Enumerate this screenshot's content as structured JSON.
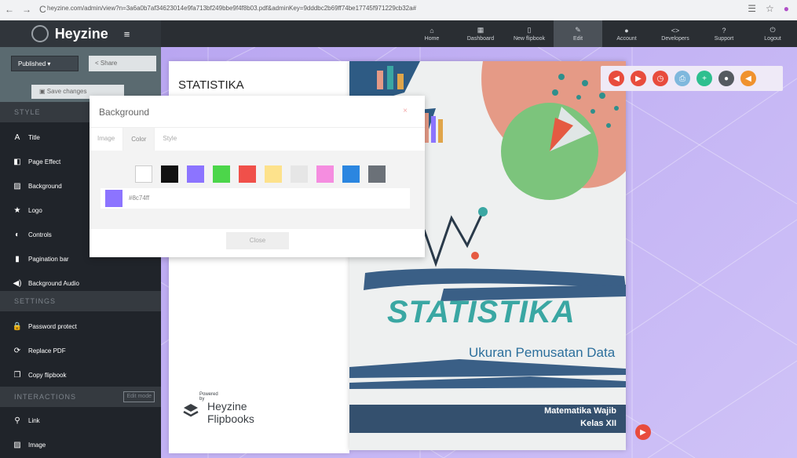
{
  "browser": {
    "back": "←",
    "forward": "→",
    "reload": "C",
    "url": "heyzine.com/admin/view?n=3a6a0b7af34623014e9fa713bf249bbe9f4f8b03.pdf&adminKey=9dddbc2b69ff74be17745f9712​29cb32a#"
  },
  "topnav": {
    "brand": "Heyzine",
    "menu_icon": "≡",
    "items": [
      {
        "label": "Home",
        "icon": "home-icon",
        "glyph": "⌂"
      },
      {
        "label": "Dashboard",
        "icon": "dashboard-icon",
        "glyph": "▦"
      },
      {
        "label": "New flipbook",
        "icon": "file-icon",
        "glyph": "▯"
      },
      {
        "label": "Edit",
        "icon": "pencil-icon",
        "glyph": "✎"
      },
      {
        "label": "Account",
        "icon": "user-icon",
        "glyph": "●"
      },
      {
        "label": "Developers",
        "icon": "code-icon",
        "glyph": "<>"
      },
      {
        "label": "Support",
        "icon": "question-icon",
        "glyph": "?"
      },
      {
        "label": "Logout",
        "icon": "power-icon",
        "glyph": "⏻"
      }
    ]
  },
  "sidebar": {
    "published_label": "Published ▾",
    "share_label": "Share",
    "save_label": "Save changes",
    "sections": {
      "style": "STYLE",
      "settings": "SETTINGS",
      "interactions": "INTERACTIONS",
      "edit_mode": "Edit mode"
    },
    "style_items": [
      {
        "label": "Title",
        "icon": "title-icon",
        "glyph": "A"
      },
      {
        "label": "Page Effect",
        "icon": "page-effect-icon",
        "glyph": "◧"
      },
      {
        "label": "Background",
        "icon": "image-icon",
        "glyph": "▨"
      },
      {
        "label": "Logo",
        "icon": "star-icon",
        "glyph": "★"
      },
      {
        "label": "Controls",
        "icon": "toggle-icon",
        "glyph": "◐"
      },
      {
        "label": "Pagination bar",
        "icon": "bookmark-icon",
        "glyph": "▮"
      },
      {
        "label": "Background Audio",
        "icon": "speaker-icon",
        "glyph": "◀)"
      }
    ],
    "settings_items": [
      {
        "label": "Password protect",
        "icon": "lock-icon",
        "glyph": "🔒"
      },
      {
        "label": "Replace PDF",
        "icon": "refresh-icon",
        "glyph": "⟳"
      },
      {
        "label": "Copy flipbook",
        "icon": "copy-icon",
        "glyph": "❐"
      }
    ],
    "interaction_items": [
      {
        "label": "Link",
        "icon": "link-icon",
        "glyph": "⚲"
      },
      {
        "label": "Image",
        "icon": "image-icon",
        "glyph": "▨"
      }
    ]
  },
  "left_page": {
    "title": "STATISTIKA"
  },
  "powered": {
    "small": "Powered by",
    "line1": "Heyzine",
    "line2": "Flipbooks"
  },
  "cover": {
    "title": "STATISTIKA",
    "subtitle": "Ukuran Pemusatan Data",
    "foot1": "Matematika Wajib",
    "foot2": "Kelas XII"
  },
  "toolbar": {
    "buttons": [
      {
        "icon": "previous-icon",
        "glyph": "◀",
        "color": "#e84c3d"
      },
      {
        "icon": "next-icon",
        "glyph": "▶",
        "color": "#e84c3d"
      },
      {
        "icon": "autoplay-icon",
        "glyph": "◷",
        "color": "#e84c3d"
      },
      {
        "icon": "print-icon",
        "glyph": "⎙",
        "color": "#7fb8dd"
      },
      {
        "icon": "zoom-in-icon",
        "glyph": "+",
        "color": "#2fbf8f"
      },
      {
        "icon": "fullscreen-icon",
        "glyph": "●",
        "color": "#555a60"
      },
      {
        "icon": "sound-icon",
        "glyph": "◀",
        "color": "#f0922e"
      }
    ],
    "next_page_glyph": "▶"
  },
  "modal": {
    "title": "Background",
    "close_x": "×",
    "tabs": [
      "Image",
      "Color",
      "Style"
    ],
    "active_tab": "Color",
    "swatches": [
      "#ffffff",
      "#111111",
      "#8c74ff",
      "#4cd64a",
      "#f0504a",
      "#fde28c",
      "#e6e6e6",
      "#f58de0",
      "#2b86e0",
      "#6b7178"
    ],
    "selected_color": "#8c74ff",
    "hex_value": "#8c74ff",
    "close_label": "Close"
  },
  "colors": {
    "accent_red": "#e84c3d",
    "sidebar_bg": "#20242a",
    "stage_purple": "#c0adf3"
  }
}
